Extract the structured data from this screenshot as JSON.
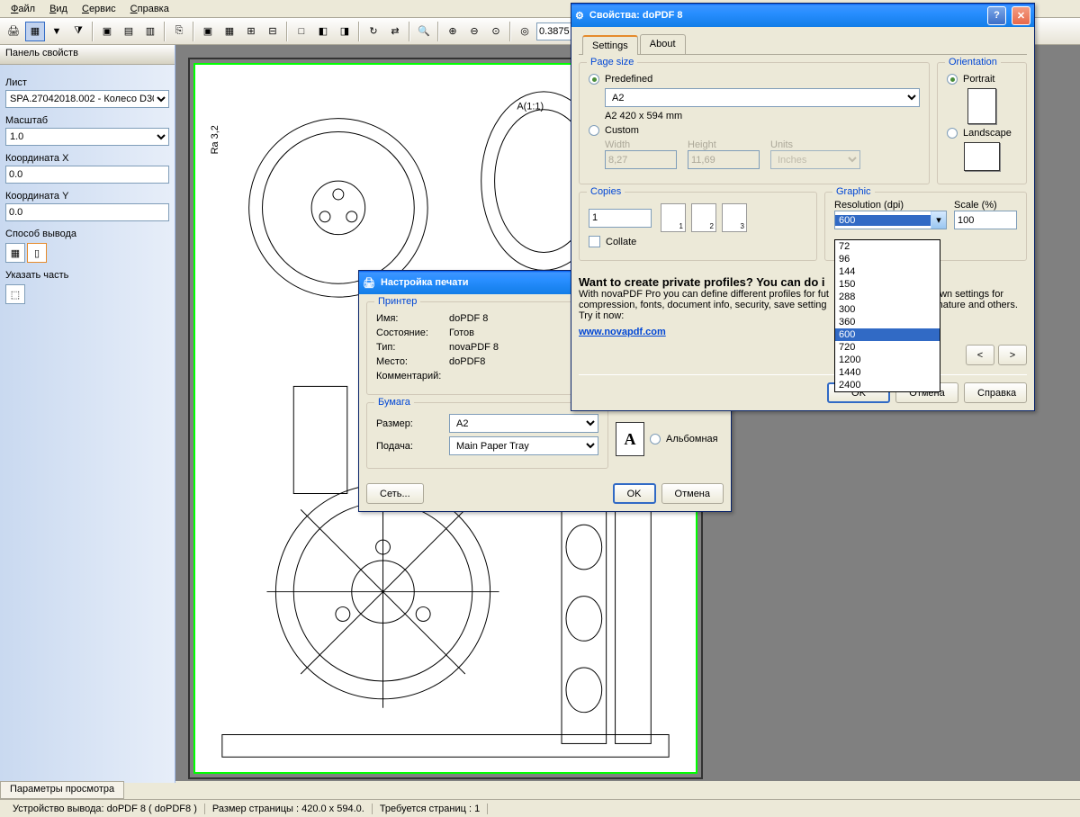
{
  "menu": {
    "file": "Файл",
    "view": "Вид",
    "service": "Сервис",
    "help": "Справка"
  },
  "toolbar": {
    "zoom_value": "0.3875"
  },
  "props_panel": {
    "title": "Панель свойств",
    "sheet_label": "Лист",
    "sheet_value": "SPA.27042018.002 - Колесо D30",
    "scale_label": "Масштаб",
    "scale_value": "1.0",
    "coord_x_label": "Координата X",
    "coord_x_value": "0.0",
    "coord_y_label": "Координата Y",
    "coord_y_value": "0.0",
    "output_label": "Способ вывода",
    "select_part_label": "Указать часть"
  },
  "print_setup": {
    "title": "Настройка печати",
    "printer_legend": "Принтер",
    "name_label": "Имя:",
    "name_value": "doPDF 8",
    "status_label": "Состояние:",
    "status_value": "Готов",
    "type_label": "Тип:",
    "type_value": "novaPDF 8",
    "location_label": "Место:",
    "location_value": "doPDF8",
    "comment_label": "Комментарий:",
    "paper_legend": "Бумага",
    "size_label": "Размер:",
    "size_value": "A2",
    "source_label": "Подача:",
    "source_value": "Main Paper Tray",
    "orient_landscape": "Альбомная",
    "network_btn": "Сеть...",
    "ok_btn": "OK",
    "cancel_btn": "Отмена"
  },
  "properties_dialog": {
    "title": "Свойства: doPDF 8",
    "tab_settings": "Settings",
    "tab_about": "About",
    "page_size_legend": "Page size",
    "predefined_label": "Predefined",
    "predefined_value": "A2",
    "predefined_desc": "A2 420 x 594 mm",
    "custom_label": "Custom",
    "width_label": "Width",
    "width_value": "8,27",
    "height_label": "Height",
    "height_value": "11,69",
    "units_label": "Units",
    "units_value": "Inches",
    "orientation_legend": "Orientation",
    "portrait_label": "Portrait",
    "landscape_label": "Landscape",
    "copies_legend": "Copies",
    "copies_value": "1",
    "collate_label": "Collate",
    "graphic_legend": "Graphic",
    "resolution_label": "Resolution (dpi)",
    "resolution_value": "600",
    "scale_label": "Scale (%)",
    "scale_value": "100",
    "dpi_options": [
      "72",
      "96",
      "144",
      "150",
      "288",
      "300",
      "360",
      "600",
      "720",
      "1200",
      "1440",
      "2400"
    ],
    "promo_heading": "Want to create private profiles? You can do i",
    "promo_text": "With novaPDF Pro you can define different profiles for fut",
    "promo_text2": "compression, fonts, document info, security, save setting",
    "promo_text3": "Try it now:",
    "promo_text_end": "wn settings for",
    "promo_text2_end": "nature and others.",
    "promo_link": "www.novapdf.com",
    "prev_btn": "<",
    "next_btn": ">",
    "ok_btn": "OK",
    "cancel_btn": "Отмена",
    "help_btn": "Справка"
  },
  "bottom_tab": "Параметры просмотра",
  "status": {
    "device": "Устройство вывода: doPDF 8 ( doPDF8 )",
    "page_size": "Размер страницы : 420.0 x 594.0.",
    "pages_needed": "Требуется страниц : 1"
  }
}
